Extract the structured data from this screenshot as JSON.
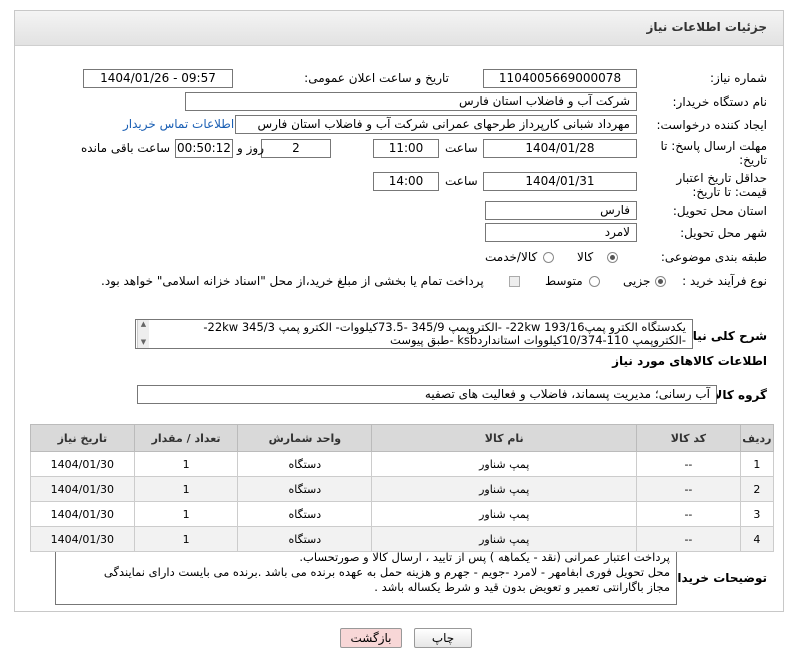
{
  "header": {
    "title": "جزئیات اطلاعات نیاز"
  },
  "fields": {
    "need_number_label": "شماره نیاز:",
    "need_number": "1104005669000078",
    "announce_label": "تاریخ و ساعت اعلان عمومی:",
    "announce_value": "1404/01/26 - 09:57",
    "buyer_org_label": "نام دستگاه خریدار:",
    "buyer_org": "شرکت آب و فاضلاب استان فارس",
    "creator_label": "ایجاد کننده درخواست:",
    "creator": "مهرداد شبانی کارپرداز طرحهای عمرانی  شرکت آب و فاضلاب استان فارس",
    "contact_link": "اطلاعات تماس خریدار",
    "deadline_label": "مهلت ارسال پاسخ: تا تاریخ:",
    "deadline_date": "1404/01/28",
    "time_label": "ساعت",
    "deadline_time": "11:00",
    "days_value": "2",
    "days_label": "روز و",
    "remaining_time": "00:50:12",
    "remaining_label": "ساعت باقی مانده",
    "validity_label": "حداقل تاریخ اعتبار قیمت: تا تاریخ:",
    "validity_date": "1404/01/31",
    "validity_time": "14:00",
    "province_label": "استان محل تحویل:",
    "province": "فارس",
    "city_label": "شهر محل تحویل:",
    "city": "لامرد",
    "category_label": "طبقه بندی موضوعی:",
    "category_goods": "کالا",
    "category_goods_service": "کالا/خدمت",
    "process_label": "نوع فرآیند خرید :",
    "process_partial": "جزیی",
    "process_medium": "متوسط",
    "payment_note": "پرداخت تمام یا بخشی از مبلغ خرید،از محل \"اسناد خزانه اسلامی\" خواهد بود."
  },
  "description": {
    "label": "شرح کلی نیاز:",
    "line1": "یکدستگاه الکترو پمپ193/16 22kw- -الکتروپمپ 345/9 -73.5کیلووات- الکترو پمپ 345/3 22kw-",
    "line2": "-الکتروپمپ 110-10/374کیلووات    استانداردksb -طبق پیوست"
  },
  "goods_section": {
    "title": "اطلاعات کالاهای مورد نیاز",
    "group_label": "گروه کالا:",
    "group_value": "آب رسانی؛ مدیریت پسماند، فاضلاب و فعالیت های تصفیه"
  },
  "table": {
    "headers": [
      "ردیف",
      "کد کالا",
      "نام کالا",
      "واحد شمارش",
      "تعداد / مقدار",
      "تاریخ نیاز"
    ],
    "rows": [
      [
        "1",
        "--",
        "پمپ شناور",
        "دستگاه",
        "1",
        "1404/01/30"
      ],
      [
        "2",
        "--",
        "پمپ شناور",
        "دستگاه",
        "1",
        "1404/01/30"
      ],
      [
        "3",
        "--",
        "پمپ شناور",
        "دستگاه",
        "1",
        "1404/01/30"
      ],
      [
        "4",
        "--",
        "پمپ شناور",
        "دستگاه",
        "1",
        "1404/01/30"
      ]
    ]
  },
  "buyer_notes": {
    "label": "توضیحات خریدار:",
    "line1": "پرداخت اعتبار  عمرانی  (نقد -  یکماهه ) پس از تایید ، ارسال کالا  و صورتحساب.",
    "line2": "محل تحویل فوری ابفامهر - لامرد -جویم - جهرم و هزینه حمل به عهده برنده می باشد .برنده می بایست دارای نمایندگی",
    "line3": "مجاز باگارانتی تعمیر و تعویض بدون قید و شرط یکساله باشد ."
  },
  "buttons": {
    "print": "چاپ",
    "back": "بازگشت"
  },
  "colors": {
    "link": "#1a5fb4",
    "back_button": "#f8d7d7"
  }
}
